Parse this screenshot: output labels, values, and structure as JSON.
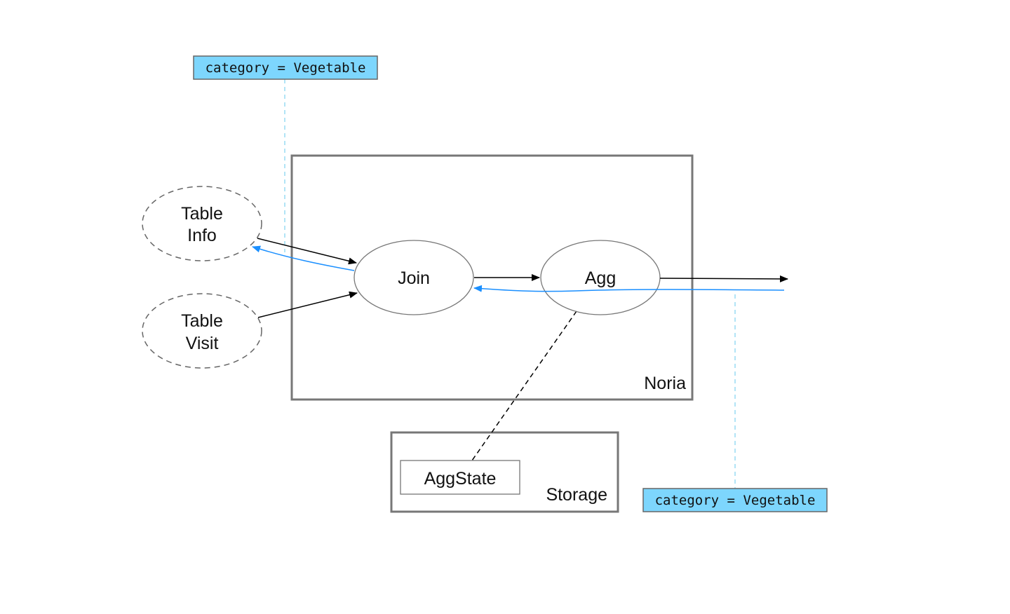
{
  "diagram": {
    "colors": {
      "tag_fill": "#7dd6fd",
      "tag_border": "#666666",
      "upquery": "#1a8fff",
      "dashed_guide": "#7fd3f0",
      "box_border": "#777777",
      "edge": "#000000"
    },
    "filters": {
      "top": {
        "text": "category = Vegetable"
      },
      "bottom": {
        "text": "category = Vegetable"
      }
    },
    "tables": {
      "info": {
        "line1": "Table",
        "line2": "Info"
      },
      "visit": {
        "line1": "Table",
        "line2": "Visit"
      }
    },
    "operators": {
      "join": {
        "label": "Join"
      },
      "agg": {
        "label": "Agg"
      }
    },
    "containers": {
      "noria": {
        "label": "Noria"
      },
      "storage": {
        "label": "Storage"
      }
    },
    "state": {
      "agg_state": {
        "label": "AggState"
      }
    },
    "edges": [
      {
        "from": "Table Info",
        "to": "Join",
        "kind": "dataflow"
      },
      {
        "from": "Table Visit",
        "to": "Join",
        "kind": "dataflow"
      },
      {
        "from": "Join",
        "to": "Agg",
        "kind": "dataflow"
      },
      {
        "from": "Agg",
        "to": "output",
        "kind": "dataflow"
      },
      {
        "from": "output",
        "to": "Join",
        "kind": "upquery"
      },
      {
        "from": "Join",
        "to": "Table Info",
        "kind": "upquery"
      },
      {
        "from": "Agg",
        "to": "AggState",
        "kind": "state-link"
      }
    ]
  }
}
